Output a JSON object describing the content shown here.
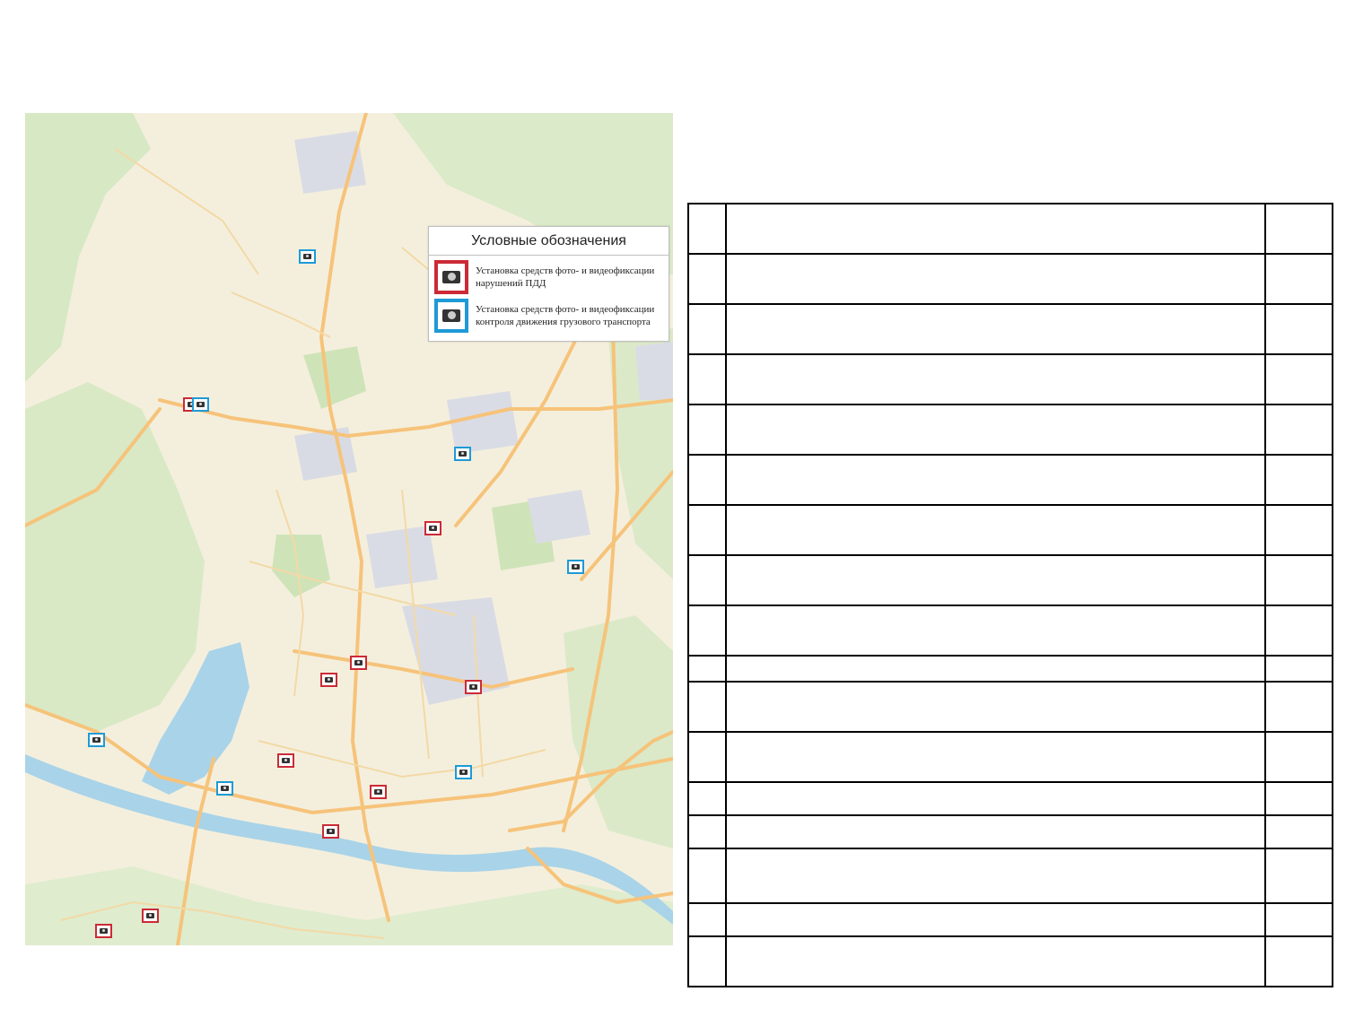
{
  "legend": {
    "title": "Условные обозначения",
    "items": [
      {
        "type": "violations",
        "color": "#cc2a36",
        "icon": "camera-icon",
        "text": "Установка средств фото- и видеофиксации нарушений ПДД"
      },
      {
        "type": "cargo",
        "color": "#1e9ad6",
        "icon": "camera-icon",
        "text": "Установка средств фото- и видеофиксации контроля движения грузового транспорта"
      }
    ]
  },
  "markers": [
    {
      "type": "cargo"
    },
    {
      "type": "violations"
    },
    {
      "type": "cargo"
    },
    {
      "type": "cargo"
    },
    {
      "type": "violations"
    },
    {
      "type": "cargo"
    },
    {
      "type": "violations"
    },
    {
      "type": "violations"
    },
    {
      "type": "violations"
    },
    {
      "type": "cargo"
    },
    {
      "type": "violations"
    },
    {
      "type": "cargo"
    },
    {
      "type": "cargo"
    },
    {
      "type": "violations"
    },
    {
      "type": "violations"
    },
    {
      "type": "violations"
    },
    {
      "type": "violations"
    }
  ],
  "table": {
    "rows": 16,
    "cells": []
  },
  "colors": {
    "violations": "#cc2a36",
    "cargo": "#1e9ad6",
    "water": "#a9d3e8",
    "forest": "#d7e8c4",
    "road": "#f6c37a"
  }
}
